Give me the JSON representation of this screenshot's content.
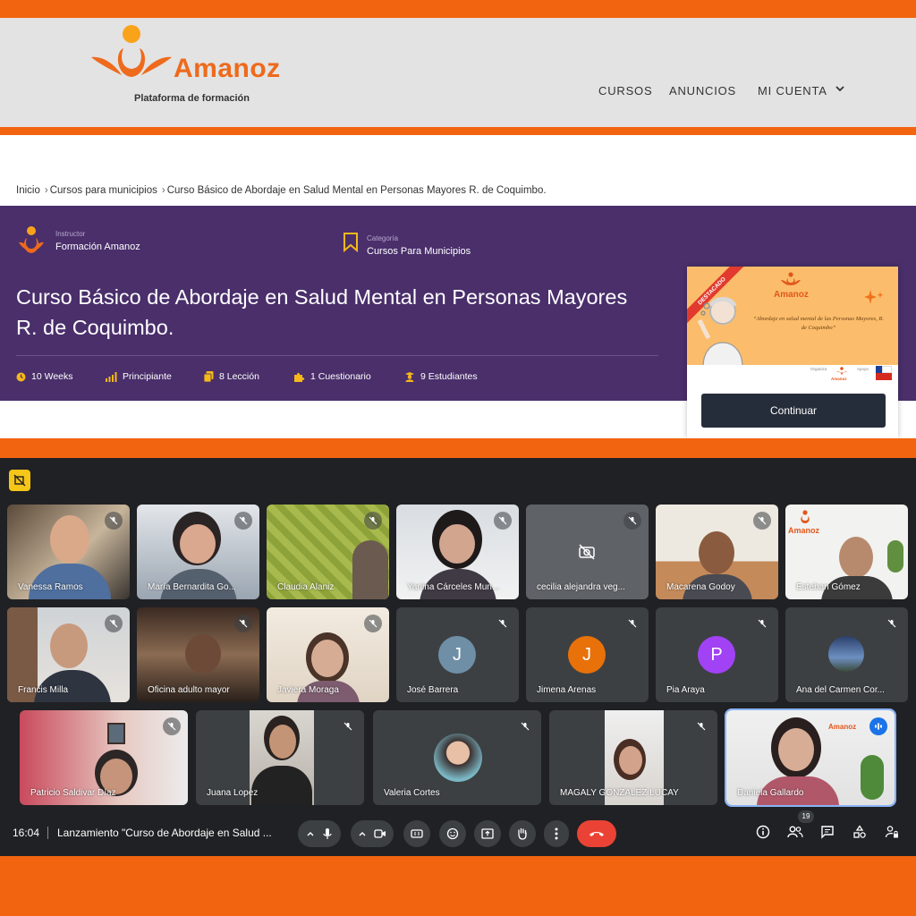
{
  "site": {
    "logo_word": "Amanoz",
    "logo_sub": "Plataforma de formación",
    "nav": [
      "CURSOS",
      "ANUNCIOS",
      "MI CUENTA"
    ],
    "breadcrumb": [
      "Inicio",
      "Cursos para municipios",
      "Curso Básico de Abordaje en Salud Mental en Personas Mayores R. de Coquimbo."
    ],
    "instructor_label": "Instructor",
    "instructor": "Formación Amanoz",
    "category_label": "Categoría",
    "category": "Cursos Para Municipios",
    "course_title": "Curso Básico de Abordaje en Salud Mental en Personas Mayores R. de Coquimbo.",
    "stats": [
      "10 Weeks",
      "Principiante",
      "8 Lección",
      "1 Cuestionario",
      "9 Estudiantes"
    ],
    "card": {
      "ribbon": "DESTACADO",
      "logo_word": "Amanoz",
      "quote": "“Abordaje en salud mental de las Personas Mayores, R. de Coquimbo”",
      "strip_left": "Organiza",
      "strip_right": "Apoya",
      "strip_logo": "Amanoz",
      "button": "Continuar"
    },
    "colors": {
      "orange": "#f2640f",
      "purple": "#4a2f6b",
      "header_gray": "#e3e3e3"
    }
  },
  "meet": {
    "participants": [
      {
        "name": "Vanessa Ramos"
      },
      {
        "name": "María Bernardita Go..."
      },
      {
        "name": "Claudia Alaniz"
      },
      {
        "name": "Yanina Cárceles Mun..."
      },
      {
        "name": "cecilia alejandra veg..."
      },
      {
        "name": "Macarena Godoy"
      },
      {
        "name": "Esteban Gómez",
        "overlay_word": "Amanoz"
      },
      {
        "name": "Francis Milla"
      },
      {
        "name": "Oficina adulto mayor"
      },
      {
        "name": "Javiera Moraga"
      },
      {
        "name": "José Barrera",
        "initial": "J",
        "color": "#6f8fa6"
      },
      {
        "name": "Jimena Arenas",
        "initial": "J",
        "color": "#e8710a"
      },
      {
        "name": "Pia Araya",
        "initial": "P",
        "color": "#a142f4"
      },
      {
        "name": "Ana del Carmen Cor..."
      },
      {
        "name": "Patricio Saldivar Díaz"
      },
      {
        "name": "Juana Lopez"
      },
      {
        "name": "Valeria Cortes"
      },
      {
        "name": "MAGALY GONZALEZ LUCAY"
      },
      {
        "name": "Daniela Gallardo",
        "overlay_word": "Amanoz"
      }
    ],
    "time": "16:04",
    "meeting_title": "Lanzamiento \"Curso de Abordaje en Salud ...",
    "participant_count": "19"
  }
}
